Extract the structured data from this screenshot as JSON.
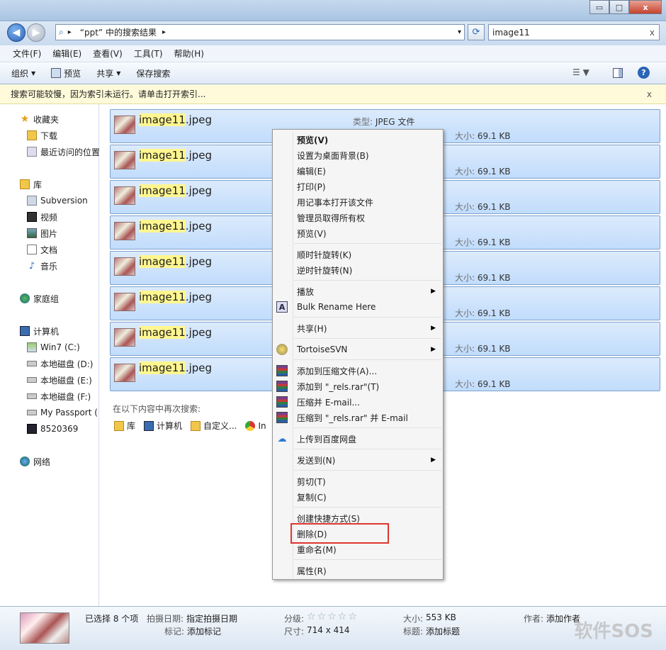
{
  "window": {
    "minimize": "▭",
    "maximize": "□",
    "close": "x"
  },
  "address": {
    "arrow": "▸",
    "path": "“ppt” 中的搜索结果",
    "path_arrow": "▸",
    "dropdown": "▾",
    "refresh": "⟳"
  },
  "search": {
    "value": "image11",
    "clear": "x"
  },
  "menu": [
    "文件(F)",
    "编辑(E)",
    "查看(V)",
    "工具(T)",
    "帮助(H)"
  ],
  "cmd": {
    "organize": "组织",
    "preview": "预览",
    "share": "共享",
    "save_search": "保存搜索"
  },
  "infobar": {
    "text": "搜索可能较慢，因为索引未运行。请单击打开索引...",
    "close": "x"
  },
  "nav": {
    "favorites": "收藏夹",
    "downloads": "下载",
    "recent": "最近访问的位置",
    "library": "库",
    "subversion": "Subversion",
    "videos": "视频",
    "pictures": "图片",
    "docs": "文档",
    "music": "音乐",
    "homegroup": "家庭组",
    "computer": "计算机",
    "c": "Win7 (C:)",
    "d": "本地磁盘 (D:)",
    "e": "本地磁盘 (E:)",
    "f": "本地磁盘 (F:)",
    "passport": "My Passport (",
    "num": "8520369",
    "network": "网络"
  },
  "files": [
    {
      "hl": "image11",
      "ext": ".jpeg",
      "type_label": "类型:",
      "type_value": "JPEG 文件",
      "size_label": "大小:",
      "size_value": "69.1 KB"
    },
    {
      "hl": "image11",
      "ext": ".jpeg",
      "size_label": "大小:",
      "size_value": "69.1 KB"
    },
    {
      "hl": "image11",
      "ext": ".jpeg",
      "size_label": "大小:",
      "size_value": "69.1 KB"
    },
    {
      "hl": "image11",
      "ext": ".jpeg",
      "size_label": "大小:",
      "size_value": "69.1 KB"
    },
    {
      "hl": "image11",
      "ext": ".jpeg",
      "size_label": "大小:",
      "size_value": "69.1 KB"
    },
    {
      "hl": "image11",
      "ext": ".jpeg",
      "size_label": "大小:",
      "size_value": "69.1 KB"
    },
    {
      "hl": "image11",
      "ext": ".jpeg",
      "size_label": "大小:",
      "size_value": "69.1 KB"
    },
    {
      "hl": "image11",
      "ext": ".jpeg",
      "size_label": "大小:",
      "size_value": "69.1 KB"
    }
  ],
  "search_again": {
    "label": "在以下内容中再次搜索:",
    "lib": "库",
    "computer": "计算机",
    "custom": "自定义...",
    "ie": "In"
  },
  "context_menu": {
    "preview_bold": "预览(V)",
    "set_bg": "设置为桌面背景(B)",
    "edit": "编辑(E)",
    "print": "打印(P)",
    "notepad": "用记事本打开该文件",
    "admin": "管理员取得所有权",
    "preview": "预览(V)",
    "rotate_cw": "顺时针旋转(K)",
    "rotate_ccw": "逆时针旋转(N)",
    "play": "播放",
    "bulk": "Bulk Rename Here",
    "share": "共享(H)",
    "svn": "TortoiseSVN",
    "add_archive": "添加到压缩文件(A)...",
    "add_rels": "添加到 \"_rels.rar\"(T)",
    "compress_email": "压缩并 E-mail...",
    "compress_rels_email": "压缩到 \"_rels.rar\" 并 E-mail",
    "baidu": "上传到百度网盘",
    "send_to": "发送到(N)",
    "cut": "剪切(T)",
    "copy": "复制(C)",
    "shortcut": "创建快捷方式(S)",
    "delete": "删除(D)",
    "rename": "重命名(M)",
    "properties": "属性(R)",
    "submenu_arrow": "▶"
  },
  "status": {
    "selected": "已选择 8 个项",
    "date_label": "拍摄日期:",
    "date_value": "指定拍摄日期",
    "tags_label": "标记:",
    "tags_value": "添加标记",
    "rating_label": "分级:",
    "stars": "☆☆☆☆☆",
    "dims_label": "尺寸:",
    "dims_value": "714 x 414",
    "size_label": "大小:",
    "size_value": "553 KB",
    "title_label": "标题:",
    "title_value": "添加标题",
    "author_label": "作者:",
    "author_value": "添加作者"
  },
  "watermark": "软件SOS"
}
